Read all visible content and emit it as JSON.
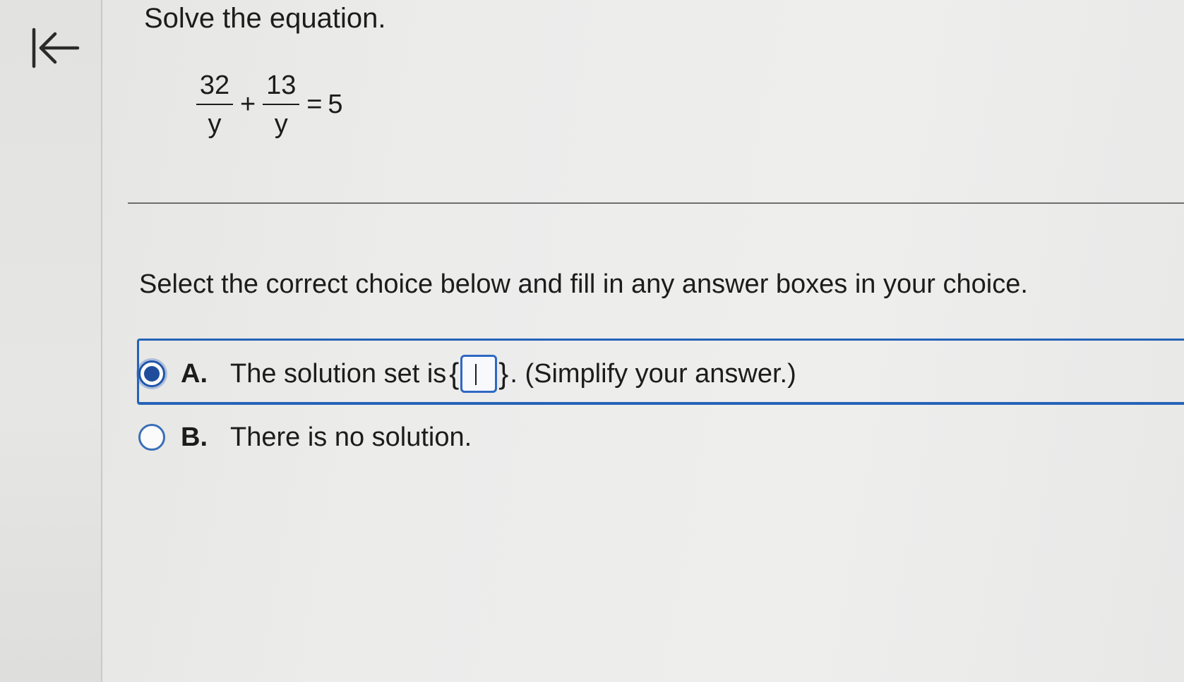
{
  "nav": {
    "back_icon": "first-page-arrow-icon"
  },
  "question": {
    "title": "Solve the equation.",
    "equation": {
      "term1": {
        "numerator": "32",
        "denominator": "y"
      },
      "operator": "+",
      "term2": {
        "numerator": "13",
        "denominator": "y"
      },
      "equals": "=",
      "rhs": "5"
    }
  },
  "instructions": "Select the correct choice below and fill in any answer boxes in your choice.",
  "choices": [
    {
      "letter": "A.",
      "text_before": "The solution set is",
      "brace_open": "{",
      "answer_value": "",
      "brace_close": "}",
      "text_after": ". (Simplify your answer.)",
      "selected": true
    },
    {
      "letter": "B.",
      "text": "There is no solution.",
      "selected": false
    }
  ],
  "colors": {
    "accent": "#2563b8",
    "radio_selected": "#1f4d9c"
  }
}
